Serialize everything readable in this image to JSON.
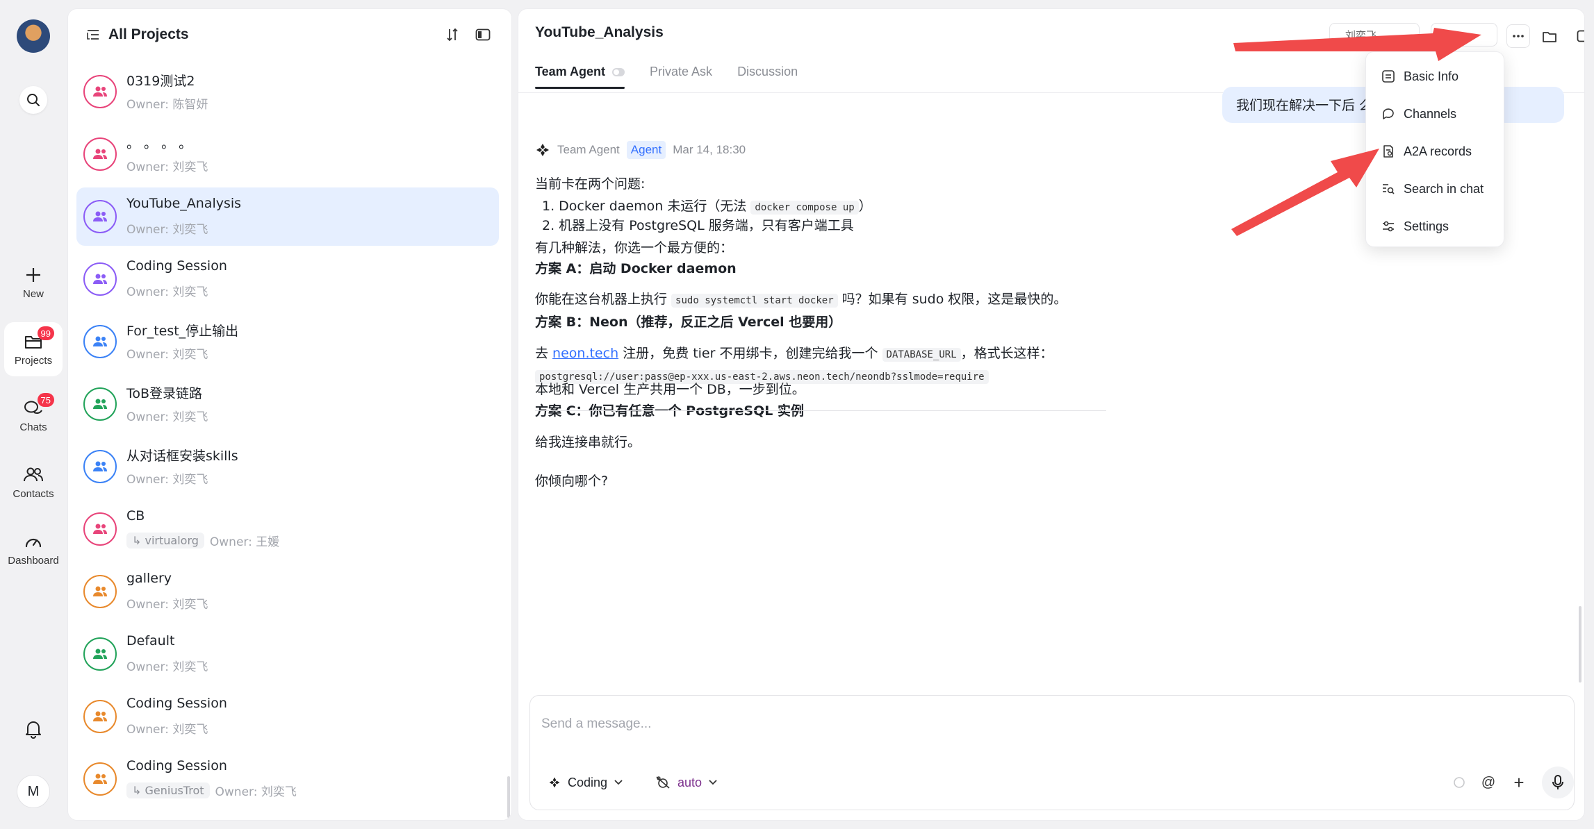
{
  "rail": {
    "new_label": "New",
    "projects_label": "Projects",
    "projects_badge": "99",
    "chats_label": "Chats",
    "chats_badge": "75",
    "contacts_label": "Contacts",
    "dashboard_label": "Dashboard",
    "me_initial": "M"
  },
  "project_list": {
    "title": "All Projects",
    "items": [
      {
        "name": "0319测试2",
        "owner": "Owner: 陈智妍",
        "color": "#e8447a"
      },
      {
        "name": "。 。 。 。",
        "owner": "Owner: 刘奕飞",
        "color": "#e8447a"
      },
      {
        "name": "YouTube_Analysis",
        "owner": "Owner: 刘奕飞",
        "color": "#8b5cf6"
      },
      {
        "name": "Coding Session",
        "owner": "Owner: 刘奕飞",
        "color": "#8b5cf6"
      },
      {
        "name": "For_test_停止输出",
        "owner": "Owner: 刘奕飞",
        "color": "#3b82f6"
      },
      {
        "name": "ToB登录链路",
        "owner": "Owner: 刘奕飞",
        "color": "#22a35a"
      },
      {
        "name": "从对话框安装skills",
        "owner": "Owner: 刘奕飞",
        "color": "#3b82f6"
      },
      {
        "name": "CB",
        "tag": "↳ virtualorg",
        "owner": "Owner: 王媛",
        "color": "#e8447a"
      },
      {
        "name": "gallery",
        "owner": "Owner: 刘奕飞",
        "color": "#e8892c"
      },
      {
        "name": "Default",
        "owner": "Owner: 刘奕飞",
        "color": "#22a35a"
      },
      {
        "name": "Coding Session",
        "owner": "Owner: 刘奕飞",
        "color": "#e8892c"
      },
      {
        "name": "Coding Session",
        "tag": "↳ GeniusTrot",
        "owner": "Owner: 刘奕飞",
        "color": "#e8892c"
      }
    ]
  },
  "main": {
    "title": "YouTube_Analysis",
    "tabs": [
      "Team Agent",
      "Private Ask",
      "Discussion"
    ],
    "top_pill_1": "刘奕飞",
    "user_bubble": "我们现在解决一下后                            么什么?",
    "message": {
      "sender": "Team Agent",
      "badge": "Agent",
      "time": "Mar 14, 18:30",
      "line1": "当前卡在两个问题:",
      "item1_pre": "1.  Docker daemon 未运行（无法 ",
      "item1_code": "docker compose up",
      "item1_post": "）",
      "item2": "2.  机器上没有 PostgreSQL 服务端，只有客户端工具",
      "line4": "有几种解法，你选一个最方便的：",
      "planA": "方案 A：启动 Docker daemon",
      "planA_pre": "你能在这台机器上执行 ",
      "planA_code": "sudo systemctl start docker",
      "planA_post": " 吗？如果有 sudo 权限，这是最快的。",
      "planB": "方案 B：Neon（推荐，反正之后 Vercel 也要用）",
      "planB_pre": "去 ",
      "planB_link": "neon.tech",
      "planB_mid": " 注册，免费 tier 不用绑卡，创建完给我一个 ",
      "planB_code": "DATABASE_URL",
      "planB_post": "，格式长这样：",
      "conn_code": "postgresql://user:pass@ep-xxx.us-east-2.aws.neon.tech/neondb?sslmode=require",
      "planB_tail": "本地和 Vercel 生产共用一个 DB，一步到位。",
      "planC": "方案 C：你已有任意一个 PostgreSQL 实例",
      "planC_text": "给我连接串就行。",
      "question": "你倾向哪个?"
    },
    "menu": [
      "Basic Info",
      "Channels",
      "A2A records",
      "Search in chat",
      "Settings"
    ],
    "composer": {
      "placeholder": "Send a message...",
      "mode_label": "Coding",
      "model_label": "auto",
      "at_symbol": "@",
      "plus_symbol": "+"
    }
  },
  "colors": {
    "accent": "#3370ff",
    "annotation_arrow": "#f04a4a"
  }
}
